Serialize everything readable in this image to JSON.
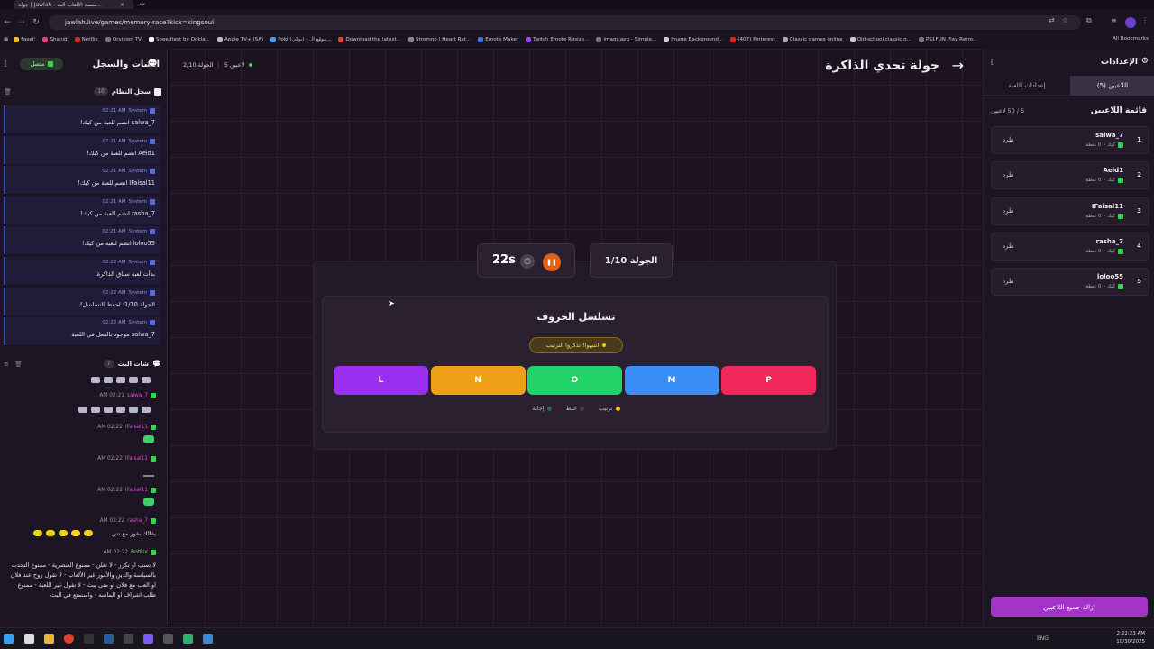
{
  "browser": {
    "tab_title": "جولة | Jawlah - منصة الألعاب الت...",
    "url": "jawlah.live/games/memory-race?kick=kingsoul",
    "bookmarks": [
      "Faselˢ",
      "Shahid",
      "Netflix",
      "Orvision TV",
      "Speedtest by Ookla...",
      "Apple TV+ (SA)",
      "Poki (بوكي) - موقع ال...",
      "Download the latest...",
      "Stromno | Heart Rat...",
      "Emote Maker",
      "Twitch Emote Resize...",
      "imagy.app - Simple...",
      "Image Background...",
      "(407) Pinterest",
      "Classic games online",
      "Old-school classic g...",
      "PS1FUN Play Retro..."
    ],
    "all_bookmarks": "All Bookmarks"
  },
  "left": {
    "title": "الشات والسجل",
    "status": "متصل",
    "syslog_title": "سجل النظام",
    "syslog_count": "10",
    "syslog": [
      {
        "time": "02:21 AM",
        "sender": "System",
        "text": "salwa_7 انضم للعبة من كيك!"
      },
      {
        "time": "02:21 AM",
        "sender": "System",
        "text": "Aeid1 انضم للعبة من كيك!"
      },
      {
        "time": "02:21 AM",
        "sender": "System",
        "text": "IFaisal11 انضم للعبة من كيك!"
      },
      {
        "time": "02:21 AM",
        "sender": "System",
        "text": "rasha_7 انضم للعبة من كيك!"
      },
      {
        "time": "02:21 AM",
        "sender": "System",
        "text": "loloo55 انضم للعبة من كيك!"
      },
      {
        "time": "02:22 AM",
        "sender": "System",
        "text": "بدأت لعبة سباق الذاكرة!"
      },
      {
        "time": "02:22 AM",
        "sender": "System",
        "text": "الجولة 1/10: احفظ التسلسل!"
      },
      {
        "time": "02:22 AM",
        "sender": "System",
        "text": "salwa_7 موجود بالفعل في اللعبة"
      }
    ],
    "chat_title": "شات البث",
    "chat_count": "7",
    "chat": [
      {
        "time": "02:21 AM",
        "name": "salwa_7",
        "text": ""
      },
      {
        "time": "02:22 AM",
        "name": "IFaisal11",
        "text": ""
      },
      {
        "time": "02:22 AM",
        "name": "IFaisal11",
        "text": ""
      },
      {
        "time": "02:22 AM",
        "name": "IFaisal11",
        "text": ""
      },
      {
        "time": "02:22 AM",
        "name": "rasha_7",
        "text": "يفالك بفوز مع نتي"
      },
      {
        "time": "02:22 AM",
        "name": "BotRix",
        "text": "لا تسب او تكرر - لا تعلن - ممنوع العنصرية - ممنوع التحدث بالسياسة والدين والأمور غير الألعاب - لا تقول روح عند فلان او العب مع فلان او متى يبث - لا تقول غير اللعبة - ممنوع طلب اشراف او الماسه - واستمتع في البث"
      }
    ]
  },
  "main": {
    "title": "جولة تحدي الذاكرة",
    "players_online": "5 لاعبين",
    "round_small": "الجولة 2/10",
    "round_label": "الجولة 1/10",
    "timer": "22s",
    "card_title": "تسلسل الحروف",
    "hint": "انتبهوا! تذكروا الترتيب",
    "letters": [
      {
        "l": "L",
        "color": "#9b2ff0"
      },
      {
        "l": "N",
        "color": "#f0a018"
      },
      {
        "l": "O",
        "color": "#22d36a"
      },
      {
        "l": "M",
        "color": "#3a8ef5"
      },
      {
        "l": "P",
        "color": "#f0285a"
      }
    ],
    "legend": [
      "ترتيب",
      "خلط",
      "إجابة"
    ]
  },
  "right": {
    "title": "الإعدادات",
    "tab_players": "اللاعبين (5)",
    "tab_settings": "إعدادات اللعبة",
    "list_title": "قائمة اللاعبين",
    "count": "5 / 50 لاعبين",
    "kick_label": "طرد",
    "players": [
      {
        "num": "1",
        "name": "salwa_7",
        "info": "كيك • 0 نقطة"
      },
      {
        "num": "2",
        "name": "Aeid1",
        "info": "كيك • 0 نقطة"
      },
      {
        "num": "3",
        "name": "IFaisal11",
        "info": "كيك • 0 نقطة"
      },
      {
        "num": "4",
        "name": "rasha_7",
        "info": "كيك • 0 نقطة"
      },
      {
        "num": "5",
        "name": "loloo55",
        "info": "كيك • 0 نقطة"
      }
    ],
    "remove_all": "إزالة جميع اللاعبين"
  },
  "taskbar": {
    "lang": "ENG",
    "time": "2:22:23 AM",
    "date": "10/30/2025"
  }
}
